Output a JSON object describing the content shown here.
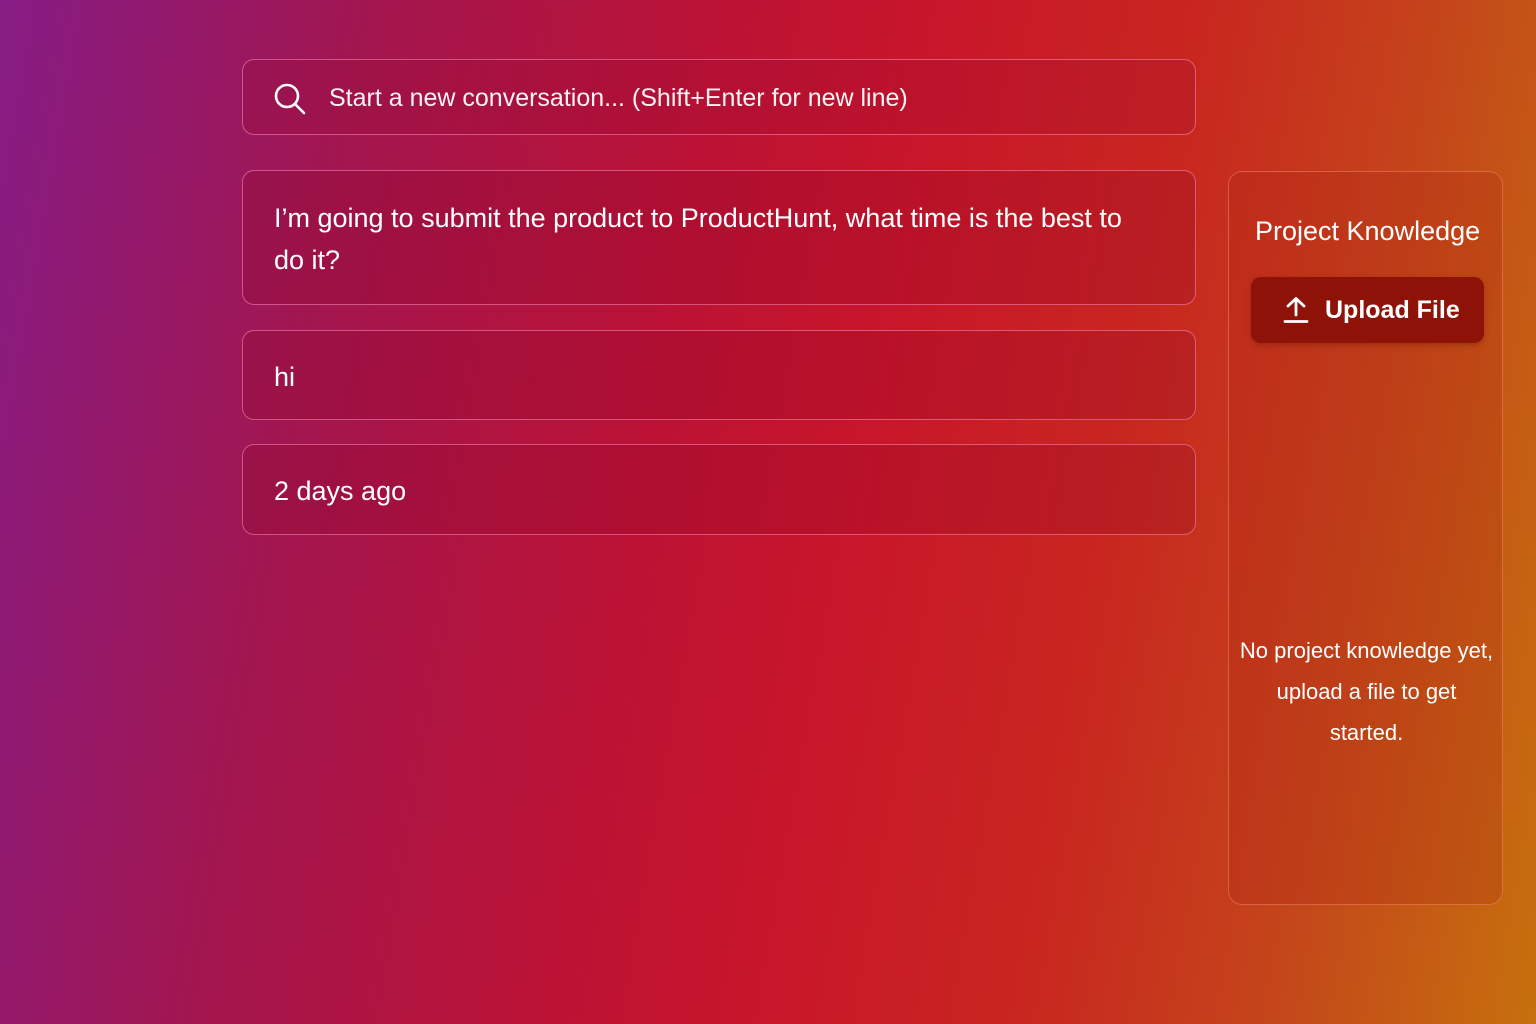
{
  "search": {
    "placeholder": "Start a new conversation... (Shift+Enter for new line)",
    "icon": "search-icon"
  },
  "conversations": [
    {
      "text": "I’m going to submit the product to ProductHunt, what time is the best to do it?"
    },
    {
      "text": "hi"
    },
    {
      "text": "2 days ago"
    }
  ],
  "knowledge_panel": {
    "title": "Project Knowledge",
    "upload_label": "Upload File",
    "upload_icon": "upload-icon",
    "empty_message": "No project knowledge yet, upload a file to get started."
  },
  "colors": {
    "gradient_start": "#861c85",
    "gradient_mid": "#c8162a",
    "gradient_end": "#c6700d",
    "upload_button": "#8f1208"
  }
}
